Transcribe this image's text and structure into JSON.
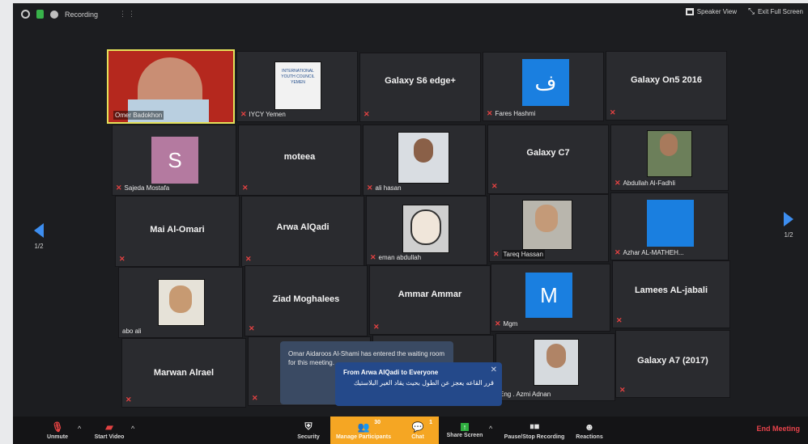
{
  "topbar": {
    "recording_label": "Recording",
    "speaker_view_label": "Speaker View",
    "exit_fullscreen_label": "Exit Full Screen"
  },
  "paging": {
    "left_page": "1/2",
    "right_page": "1/2"
  },
  "tiles": [
    {
      "name": "Omer Badokhon"
    },
    {
      "name": "IYCY Yemen",
      "logo_text": "INTERNATIONAL YOUTH COUNCIL YEMEN"
    },
    {
      "name": "Galaxy S6 edge+"
    },
    {
      "name": "Fares Hashmi",
      "avatar": "ف"
    },
    {
      "name": "Galaxy On5 2016"
    },
    {
      "name": "Sajeda Mostafa",
      "avatar": "S"
    },
    {
      "name": "moteea"
    },
    {
      "name": "ali hasan"
    },
    {
      "name": "Galaxy C7"
    },
    {
      "name": "Abdullah Al-Fadhli"
    },
    {
      "name": "Mai Al-Omari"
    },
    {
      "name": "Arwa AlQadi"
    },
    {
      "name": "eman abdullah"
    },
    {
      "name": "Tareq Hassan"
    },
    {
      "name": "Azhar AL-MATHEH..."
    },
    {
      "name": "abo ali"
    },
    {
      "name": "Ziad Moghalees"
    },
    {
      "name": "Ammar Ammar"
    },
    {
      "name": "Mgm",
      "avatar": "M"
    },
    {
      "name": "Lamees AL-jabali"
    },
    {
      "name": "Marwan Alrael"
    },
    {
      "name": "Eng . Azmi Adnan"
    },
    {
      "name": "Galaxy A7 (2017)"
    }
  ],
  "waiting_toast": "Omar Aidaroos Al-Shami has entered the waiting room for this meeting.",
  "chat_popup": {
    "from": "From Arwa AlQadi to Everyone",
    "message": "قرر القاعه يعجز عن الطول بحيث يقاد الغير البلاستيك"
  },
  "toolbar": {
    "unmute": "Unmute",
    "start_video": "Start Video",
    "security": "Security",
    "manage_participants": "Manage Participants",
    "participants_count": "30",
    "chat": "Chat",
    "chat_count": "1",
    "share_screen": "Share Screen",
    "pause_recording": "Pause/Stop Recording",
    "reactions": "Reactions",
    "end_meeting": "End Meeting"
  },
  "colors": {
    "active_speaker_border": "#e4e15a",
    "avatar_sajeda": "#b47aa0",
    "avatar_blue": "#1a7fe0",
    "manage_participants_bg": "#f5a623",
    "end_meeting": "#e8434b",
    "share_screen_green": "#2fae3f"
  }
}
